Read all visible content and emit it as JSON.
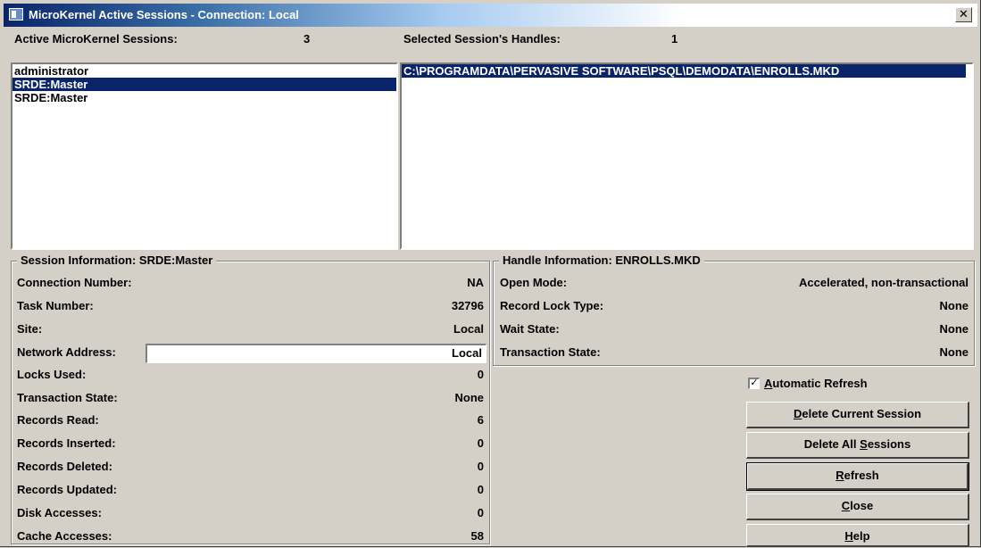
{
  "window": {
    "title": "MicroKernel Active Sessions  -  Connection: Local",
    "close_glyph": "✕"
  },
  "sessions": {
    "label": "Active MicroKernel Sessions:",
    "count": "3",
    "items": [
      "administrator",
      "SRDE:Master",
      "SRDE:Master"
    ],
    "selected_index": 1
  },
  "handles": {
    "label": "Selected Session's Handles:",
    "count": "1",
    "items": [
      "C:\\PROGRAMDATA\\PERVASIVE SOFTWARE\\PSQL\\DEMODATA\\ENROLLS.MKD"
    ]
  },
  "session_info": {
    "title": "Session Information: SRDE:Master",
    "connection_number": {
      "label": "Connection Number:",
      "value": "NA"
    },
    "task_number": {
      "label": "Task Number:",
      "value": "32796"
    },
    "site": {
      "label": "Site:",
      "value": "Local"
    },
    "network_address": {
      "label": "Network Address:",
      "value": "Local"
    },
    "locks_used": {
      "label": "Locks Used:",
      "value": "0"
    },
    "transaction_state": {
      "label": "Transaction State:",
      "value": "None"
    },
    "records_read": {
      "label": "Records Read:",
      "value": "6"
    },
    "records_inserted": {
      "label": "Records Inserted:",
      "value": "0"
    },
    "records_deleted": {
      "label": "Records Deleted:",
      "value": "0"
    },
    "records_updated": {
      "label": "Records Updated:",
      "value": "0"
    },
    "disk_accesses": {
      "label": "Disk Accesses:",
      "value": "0"
    },
    "cache_accesses": {
      "label": "Cache Accesses:",
      "value": "58"
    }
  },
  "handle_info": {
    "title": "Handle Information: ENROLLS.MKD",
    "open_mode": {
      "label": "Open Mode:",
      "value": "Accelerated, non-transactional"
    },
    "record_lock_type": {
      "label": "Record Lock Type:",
      "value": "None"
    },
    "wait_state": {
      "label": "Wait State:",
      "value": "None"
    },
    "transaction_state": {
      "label": "Transaction State:",
      "value": "None"
    }
  },
  "controls": {
    "auto_refresh": {
      "label_rest": "utomatic Refresh",
      "label_accel": "A",
      "checked": true,
      "check_glyph": "✓"
    },
    "delete_current": {
      "accel": "D",
      "rest": "elete Current Session"
    },
    "delete_all": {
      "pre": "Delete All ",
      "accel": "S",
      "rest": "essions"
    },
    "refresh": {
      "accel": "R",
      "rest": "efresh"
    },
    "close": {
      "accel": "C",
      "rest": "lose"
    },
    "help": {
      "accel": "H",
      "rest": "elp"
    }
  }
}
